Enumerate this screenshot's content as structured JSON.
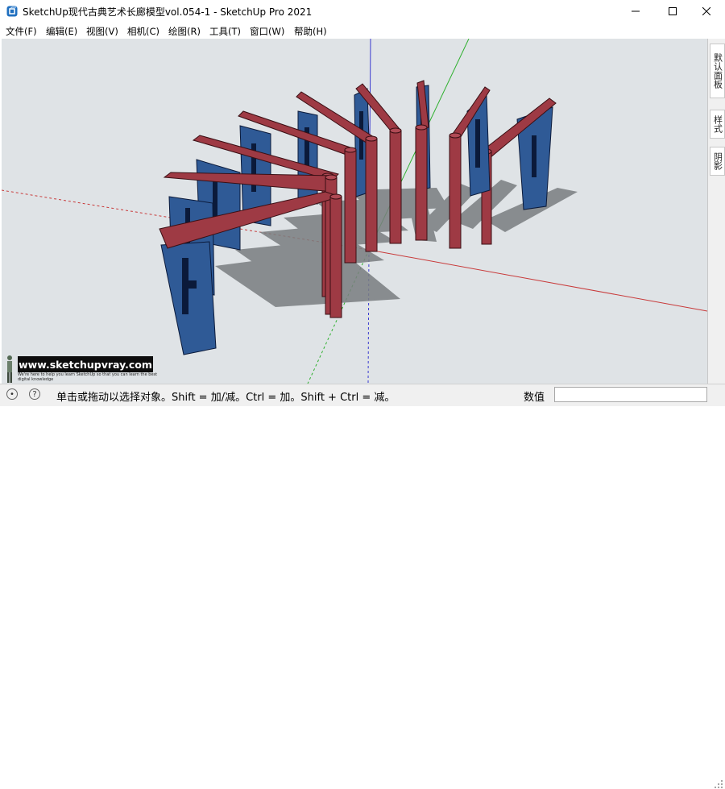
{
  "window": {
    "title": "SketchUp现代古典艺术长廊模型vol.054-1 - SketchUp Pro 2021",
    "app_icon": "sketchup-logo-icon",
    "controls": [
      "minimize-icon",
      "maximize-icon",
      "close-icon"
    ]
  },
  "menu": {
    "items": [
      "文件(F)",
      "编辑(E)",
      "视图(V)",
      "相机(C)",
      "绘图(R)",
      "工具(T)",
      "窗口(W)",
      "帮助(H)"
    ]
  },
  "right_panel": {
    "tabs": [
      "默认面板",
      "样式",
      "阴影"
    ]
  },
  "watermark": {
    "site": "www.sketchupvray.com",
    "tagline": "We're here to help you learn SketchUp so that you can learn the best digital knowledge"
  },
  "status": {
    "hint": "单击或拖动以选择对象。Shift = 加/减。Ctrl = 加。Shift + Ctrl = 减。",
    "value_label": "数值",
    "value": "",
    "icons": [
      "geo-location-icon",
      "info-icon"
    ]
  },
  "colors": {
    "viewport_bg": "#dfe3e6",
    "beam_red": "#9e3a44",
    "panel_blue": "#2f5a96",
    "axis_red": "#c83a3a",
    "axis_green": "#2fb02f",
    "axis_blue": "#3a3ad0"
  }
}
